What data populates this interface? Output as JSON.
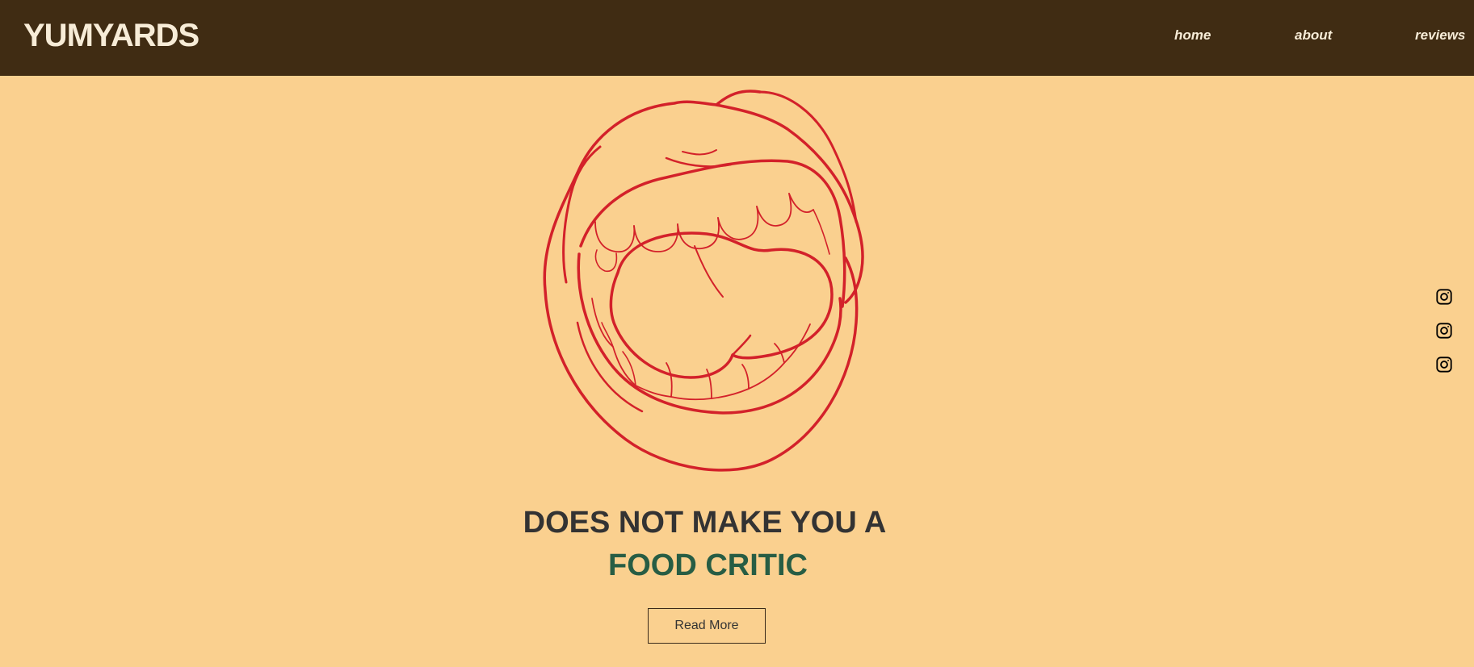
{
  "brand": {
    "logo_text": "YUMYARDS"
  },
  "nav": {
    "items": [
      {
        "label": "home"
      },
      {
        "label": "about"
      },
      {
        "label": "reviews"
      }
    ]
  },
  "hero": {
    "illustration": "open-mouth-illustration",
    "headline_line1": "DOES NOT MAKE YOU A",
    "headline_line2": "FOOD CRITIC",
    "button_label": "Read More"
  },
  "social": {
    "icons": [
      "instagram-icon",
      "instagram-icon",
      "instagram-icon"
    ]
  },
  "colors": {
    "header_bg": "#402c13",
    "page_bg": "#fad08f",
    "accent_green": "#275d44",
    "illustration_red": "#d3212a",
    "text_dark": "#333333",
    "header_text": "#f7ecd7"
  }
}
